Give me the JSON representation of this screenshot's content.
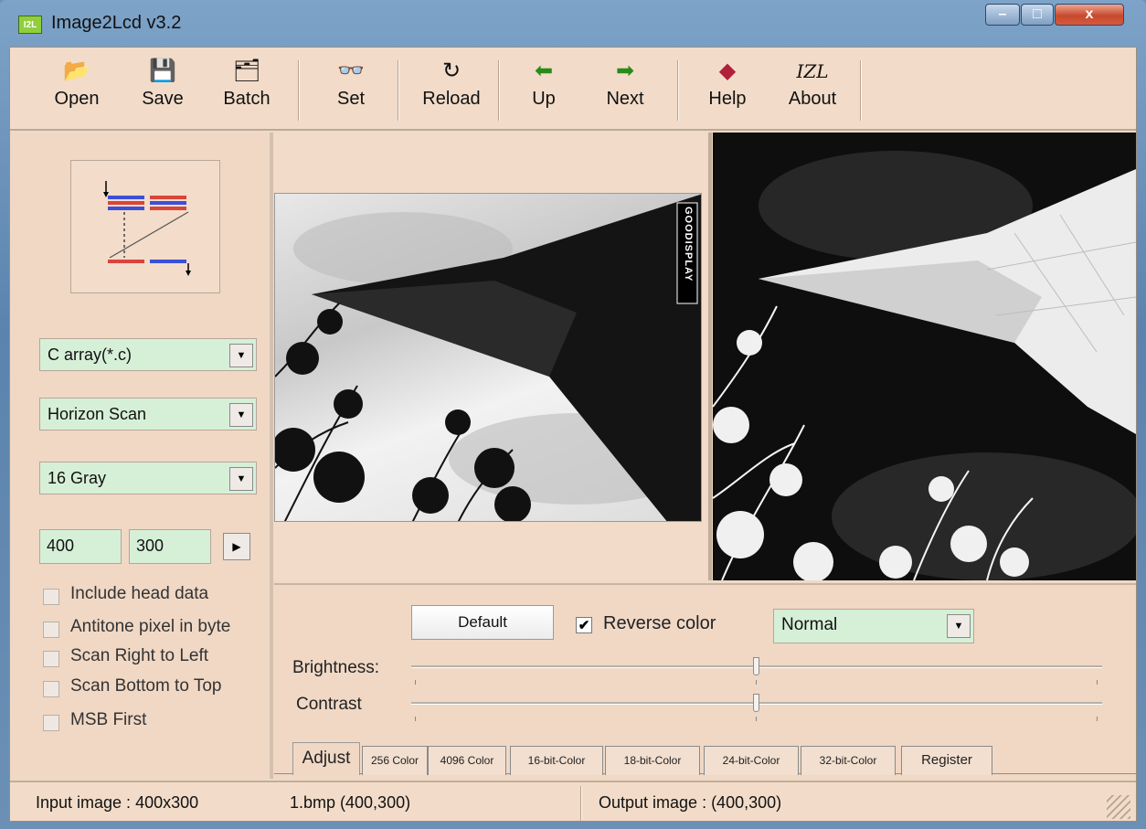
{
  "window": {
    "app_icon_text": "I2L",
    "title": "Image2Lcd v3.2",
    "controls": {
      "minimize": "–",
      "maximize": "□",
      "close": "x"
    }
  },
  "toolbar": [
    {
      "label": "Open",
      "icon": "open-icon",
      "glyph": "📂"
    },
    {
      "label": "Save",
      "icon": "save-icon",
      "glyph": "💾"
    },
    {
      "label": "Batch",
      "icon": "batch-icon",
      "glyph": "🗂"
    },
    {
      "label": "Set",
      "icon": "glasses-icon",
      "glyph": "👓"
    },
    {
      "label": "Reload",
      "icon": "reload-icon",
      "glyph": "↻"
    },
    {
      "label": "Up",
      "icon": "arrow-left-icon",
      "glyph": "⬅"
    },
    {
      "label": "Next",
      "icon": "arrow-right-icon",
      "glyph": "➡"
    },
    {
      "label": "Help",
      "icon": "help-icon",
      "glyph": "◆"
    },
    {
      "label": "About",
      "icon": "about-icon",
      "glyph": "IZL"
    }
  ],
  "left": {
    "output_type": "C array(*.c)",
    "scan_mode": "Horizon Scan",
    "bits_pixel": "16 Gray",
    "width": "400",
    "height": "300",
    "options": [
      {
        "label": "Include head data",
        "checked": false
      },
      {
        "label": "Antitone pixel in byte",
        "checked": false
      },
      {
        "label": "Scan Right to Left",
        "checked": false
      },
      {
        "label": "Scan Bottom to Top",
        "checked": false
      },
      {
        "label": "MSB First",
        "checked": false
      }
    ]
  },
  "preview": {
    "watermark": "GOODISPLAY"
  },
  "adjust": {
    "default_label": "Default",
    "reverse_label": "Reverse color",
    "reverse_checked": true,
    "reverse_mark": "✔",
    "mode": "Normal",
    "brightness_label": "Brightness:",
    "contrast_label": "Contrast",
    "brightness_value": 0.5,
    "contrast_value": 0.5
  },
  "tabs": [
    "Adjust",
    "256 Color",
    "4096 Color",
    "16-bit-Color",
    "18-bit-Color",
    "24-bit-Color",
    "32-bit-Color",
    "Register"
  ],
  "status": {
    "input": "Input image : 400x300",
    "file": "1.bmp  (400,300)",
    "output": "Output image : (400,300)"
  },
  "colors": {
    "window_bg": "#f0d8c5",
    "field_green": "#d6f0d8",
    "scan_red": "#d9443b",
    "scan_blue": "#3b4fd9"
  }
}
